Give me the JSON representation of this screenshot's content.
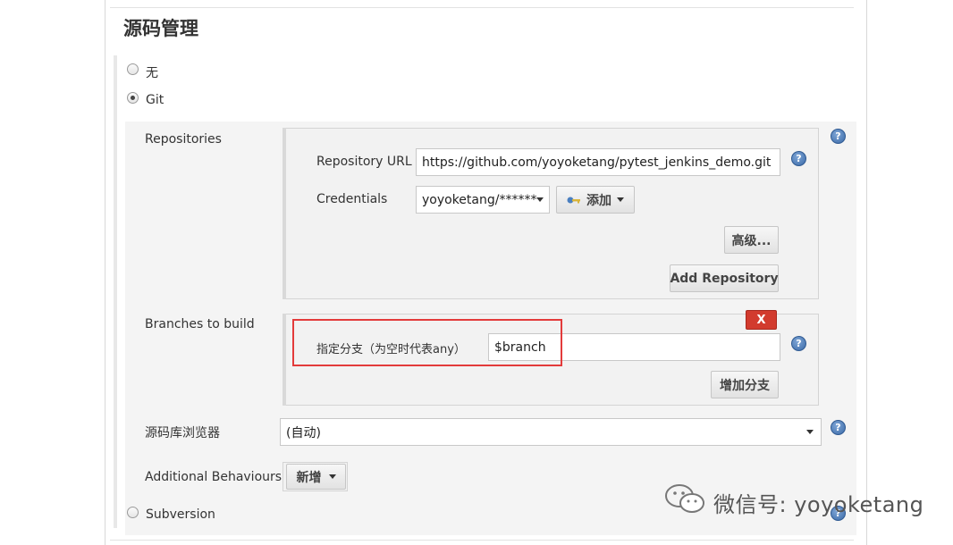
{
  "section_title": "源码管理",
  "scm_options": {
    "none": "无",
    "git": "Git",
    "subversion": "Subversion"
  },
  "git": {
    "repositories_label": "Repositories",
    "repository_url_label": "Repository URL",
    "repository_url_value": "https://github.com/yoyoketang/pytest_jenkins_demo.git",
    "credentials_label": "Credentials",
    "credentials_value": "yoyoketang/******",
    "add_label": "添加",
    "advanced_label": "高级...",
    "add_repository_label": "Add Repository",
    "branches_label": "Branches to build",
    "branch_spec_label": "指定分支（为空时代表any）",
    "branch_spec_value": "$branch",
    "delete_label": "X",
    "add_branch_label": "增加分支",
    "repo_browser_label": "源码库浏览器",
    "repo_browser_value": "(自动)",
    "additional_behaviours_label": "Additional Behaviours",
    "new_label": "新增"
  },
  "help_glyph": "?",
  "watermark": "微信号: yoyoketang",
  "colors": {
    "delete_button": "#d23b2e",
    "highlight_box": "#e33b3b",
    "help_icon": "#3b6aa8"
  }
}
